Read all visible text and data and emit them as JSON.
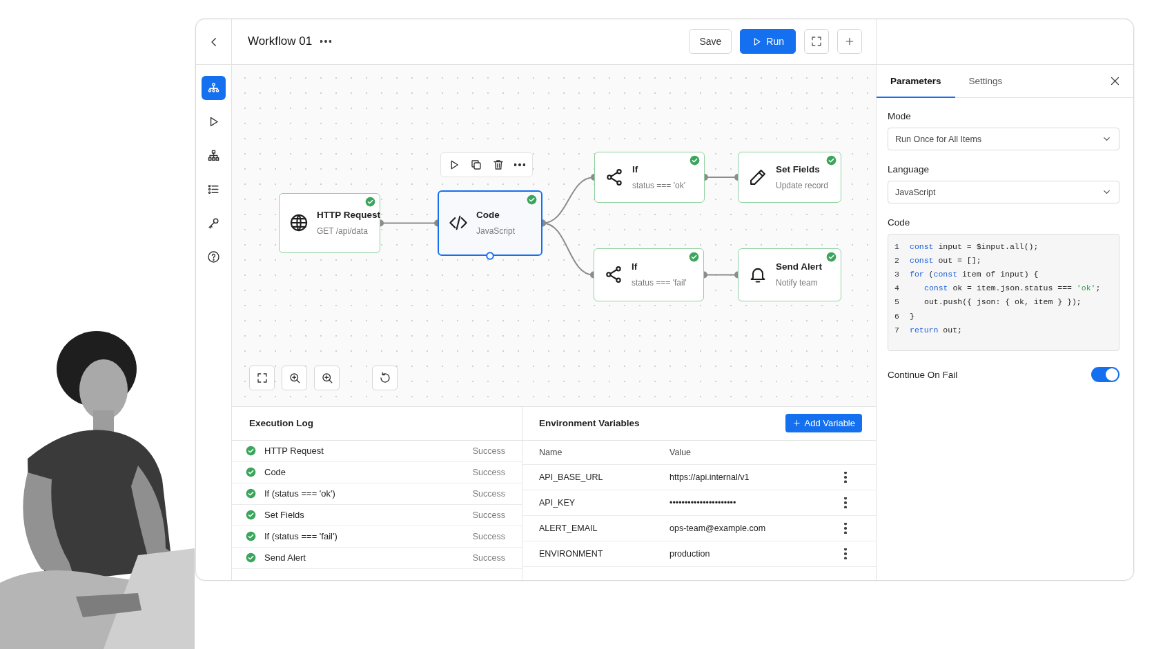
{
  "topbar": {
    "title": "Workflow 01",
    "buttons": [
      {
        "label": "Save",
        "primary": false
      },
      {
        "label": "Run",
        "primary": true
      }
    ]
  },
  "rail": [
    {
      "kind": "workflow",
      "selected": true
    },
    {
      "kind": "play",
      "selected": false
    },
    {
      "kind": "hierarchy",
      "selected": false
    },
    {
      "kind": "list",
      "selected": false
    },
    {
      "kind": "key",
      "selected": false
    },
    {
      "kind": "help",
      "selected": false
    }
  ],
  "canvas": {
    "nodes": [
      {
        "kind": "http",
        "title": "HTTP Request",
        "subtitle": "GET /api/data",
        "success": true,
        "selected": false
      },
      {
        "kind": "code",
        "title": "Code",
        "subtitle": "JavaScript",
        "success": true,
        "selected": true
      },
      {
        "kind": "if",
        "title": "If",
        "subtitle": "status === 'ok'",
        "success": true,
        "selected": false
      },
      {
        "kind": "set",
        "title": "Set Fields",
        "subtitle": "Update record",
        "success": true,
        "selected": false
      },
      {
        "kind": "if",
        "title": "If",
        "subtitle": "status === 'fail'",
        "success": true,
        "selected": false
      },
      {
        "kind": "alert",
        "title": "Send Alert",
        "subtitle": "Notify team",
        "success": true,
        "selected": false
      }
    ]
  },
  "execution_log": {
    "title": "Execution Log",
    "rows": [
      {
        "name": "HTTP Request",
        "status": "Success",
        "success": true
      },
      {
        "name": "Code",
        "status": "Success",
        "success": true
      },
      {
        "name": "If (status === 'ok')",
        "status": "Success",
        "success": true
      },
      {
        "name": "Set Fields",
        "status": "Success",
        "success": true
      },
      {
        "name": "If (status === 'fail')",
        "status": "Success",
        "success": true
      },
      {
        "name": "Send Alert",
        "status": "Success",
        "success": true
      }
    ]
  },
  "environment_variables": {
    "title": "Environment Variables",
    "add_button": "Add Variable",
    "columns": [
      "Name",
      "Value"
    ],
    "rows": [
      {
        "name": "API_BASE_URL",
        "value": "https://api.internal/v1"
      },
      {
        "name": "API_KEY",
        "value": "••••••••••••••••••••••"
      },
      {
        "name": "ALERT_EMAIL",
        "value": "ops-team@example.com"
      },
      {
        "name": "ENVIRONMENT",
        "value": "production"
      }
    ]
  },
  "panel": {
    "tabs": [
      {
        "label": "Parameters",
        "selected": true
      },
      {
        "label": "Settings",
        "selected": false
      }
    ],
    "fields": [
      {
        "label": "Mode",
        "value": "Run Once for All Items"
      },
      {
        "label": "Language",
        "value": "JavaScript"
      }
    ],
    "code_label": "Code",
    "code": [
      {
        "number": "1",
        "indented": false,
        "tokens": [
          {
            "kind": "keyword",
            "text": "const"
          },
          {
            "kind": "plain",
            "text": " input = $input.all();"
          }
        ]
      },
      {
        "number": "2",
        "indented": false,
        "tokens": [
          {
            "kind": "keyword",
            "text": "const"
          },
          {
            "kind": "plain",
            "text": " out = [];"
          }
        ]
      },
      {
        "number": "3",
        "indented": false,
        "tokens": [
          {
            "kind": "keyword",
            "text": "for"
          },
          {
            "kind": "plain",
            "text": " ("
          },
          {
            "kind": "keyword",
            "text": "const"
          },
          {
            "kind": "plain",
            "text": " item of input) {"
          }
        ]
      },
      {
        "number": "4",
        "indented": true,
        "tokens": [
          {
            "kind": "keyword",
            "text": "const"
          },
          {
            "kind": "plain",
            "text": " ok = item.json.status === "
          },
          {
            "kind": "string",
            "text": "'ok'"
          },
          {
            "kind": "plain",
            "text": ";"
          }
        ]
      },
      {
        "number": "5",
        "indented": true,
        "tokens": [
          {
            "kind": "plain",
            "text": "out.push({ json: { ok, item } });"
          }
        ]
      },
      {
        "number": "6",
        "indented": false,
        "tokens": [
          {
            "kind": "plain",
            "text": "}"
          }
        ]
      },
      {
        "number": "7",
        "indented": false,
        "tokens": [
          {
            "kind": "keyword",
            "text": "return"
          },
          {
            "kind": "plain",
            "text": " out;"
          }
        ]
      }
    ],
    "continue_on_fail": {
      "label": "Continue On Fail",
      "on": true
    }
  }
}
